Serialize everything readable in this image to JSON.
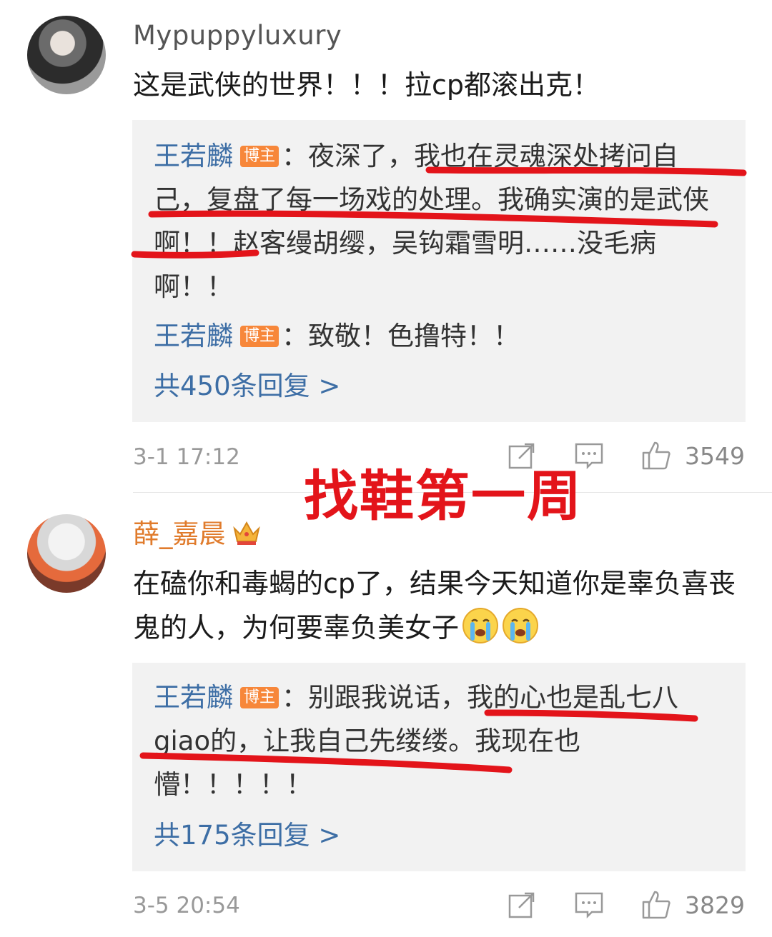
{
  "comments": [
    {
      "username": "Mypuppyluxury",
      "text": "这是武侠的世界！！！拉cp都滚出克！",
      "replies": [
        {
          "author": "王若麟",
          "badge": "博主",
          "text": "：夜深了，我也在灵魂深处拷问自己，复盘了每一场戏的处理。我确实演的是武侠啊！！赵客缦胡缨，吴钩霜雪明……没毛病啊！！"
        },
        {
          "author": "王若麟",
          "badge": "博主",
          "text": "：致敬！色撸特！！"
        }
      ],
      "more_replies": "共450条回复 >",
      "timestamp": "3-1 17:12",
      "likes": "3549"
    },
    {
      "username": "薛_嘉晨",
      "text": "在磕你和毒蝎的cp了，结果今天知道你是辜负喜丧鬼的人，为何要辜负美女子",
      "replies": [
        {
          "author": "王若麟",
          "badge": "博主",
          "text": "：别跟我说话，我的心也是乱七八giao的，让我自己先缕缕。我现在也懵！！！！！"
        }
      ],
      "more_replies": "共175条回复 >",
      "timestamp": "3-5 20:54",
      "likes": "3829"
    }
  ],
  "overlay_caption": "找鞋第一周",
  "icons": {
    "share": "share-icon",
    "comment": "comment-icon",
    "like": "thumbs-up-icon",
    "crown": "crown-icon",
    "crying": "crying-emoji-icon"
  },
  "colors": {
    "author_link": "#3d6ea5",
    "badge": "#f7873a",
    "vip_username": "#e07b2c",
    "annotation_red": "#e3141a"
  }
}
